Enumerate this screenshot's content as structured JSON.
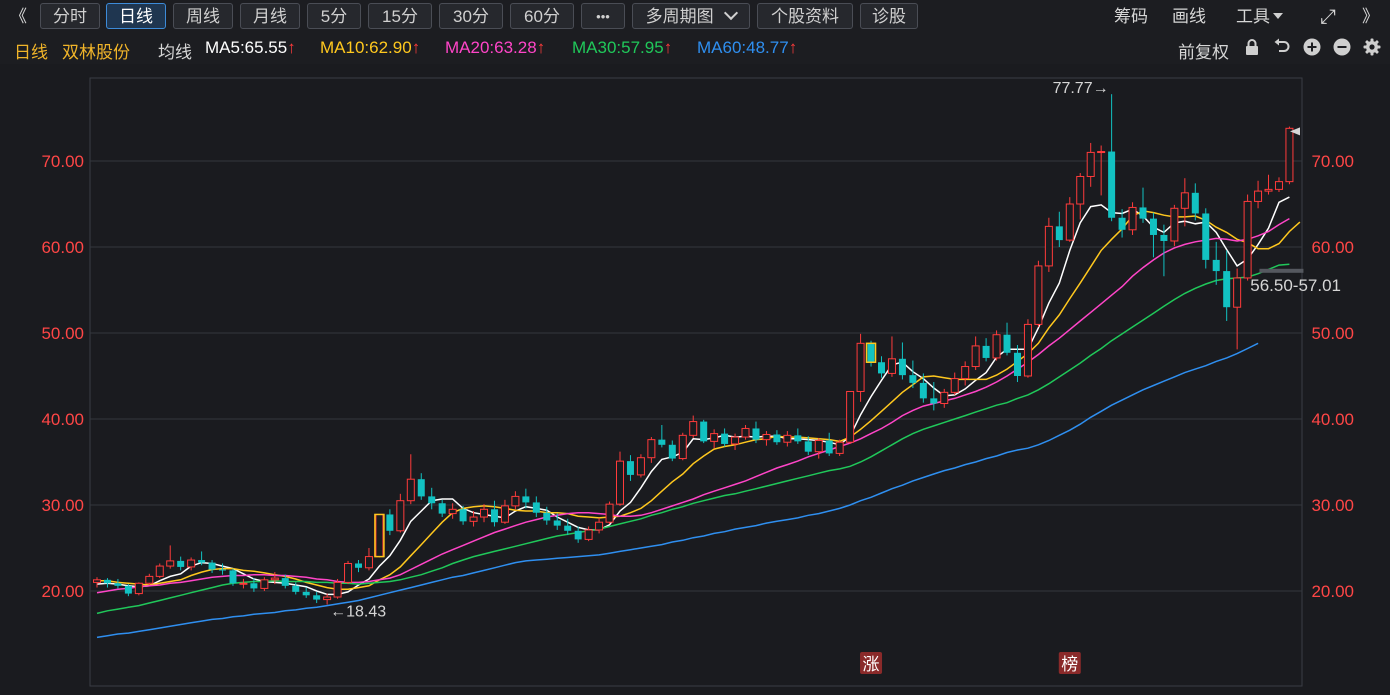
{
  "toolbar": {
    "back_glyph": "《",
    "tabs": [
      "分时",
      "日线",
      "周线",
      "月线",
      "5分",
      "15分",
      "30分",
      "60分",
      "•••"
    ],
    "multi_period": "多周期图",
    "stock_info": "个股资料",
    "diagnose": "诊股",
    "chips": "筹码",
    "draw": "画线",
    "tools": "工具",
    "expand_glyph": "⤢",
    "collapse_glyph": "》"
  },
  "legend": {
    "period": "日线",
    "stock_name": "双林股份",
    "ma_label": "均线",
    "ma5": "MA5:65.55",
    "ma10": "MA10:62.90",
    "ma20": "MA20:63.28",
    "ma30": "MA30:57.95",
    "ma60": "MA60:48.77",
    "adjust": "前复权"
  },
  "colors": {
    "up": "#ff3b3b",
    "down": "#12c2c2",
    "ma5": "#ffffff",
    "ma10": "#ffc81e",
    "ma20": "#ff45c8",
    "ma30": "#20c85a",
    "ma60": "#2f8ff0",
    "axis_text": "#ff4646"
  },
  "markers": {
    "zhang": "涨",
    "bang": "榜"
  },
  "chart_data": {
    "type": "candlestick",
    "ylim": [
      12,
      82
    ],
    "yticks": [
      "20.00",
      "30.00",
      "40.00",
      "50.00",
      "60.00",
      "70.00"
    ],
    "annotations": {
      "high": "77.77→",
      "low": "←18.43",
      "range": "56.50-57.01"
    },
    "candles": [
      [
        21.0,
        21.6,
        20.4,
        21.3
      ],
      [
        21.3,
        21.5,
        20.4,
        20.9
      ],
      [
        20.9,
        21.4,
        20.3,
        20.6
      ],
      [
        20.6,
        20.8,
        19.4,
        19.7
      ],
      [
        19.7,
        21.0,
        19.5,
        20.9
      ],
      [
        20.9,
        22.0,
        20.7,
        21.7
      ],
      [
        21.7,
        23.2,
        21.5,
        22.9
      ],
      [
        22.9,
        25.3,
        22.6,
        23.5
      ],
      [
        23.5,
        24.0,
        22.4,
        22.8
      ],
      [
        22.8,
        23.9,
        22.4,
        23.6
      ],
      [
        23.6,
        24.6,
        23.0,
        23.3
      ],
      [
        23.3,
        23.6,
        22.1,
        22.5
      ],
      [
        22.5,
        23.2,
        21.9,
        22.4
      ],
      [
        22.4,
        22.6,
        20.6,
        20.9
      ],
      [
        20.9,
        21.4,
        20.3,
        20.9
      ],
      [
        20.9,
        21.5,
        19.9,
        20.3
      ],
      [
        20.3,
        21.6,
        20.0,
        21.3
      ],
      [
        21.3,
        22.2,
        20.8,
        21.5
      ],
      [
        21.5,
        21.9,
        20.3,
        20.6
      ],
      [
        20.6,
        21.0,
        19.6,
        19.9
      ],
      [
        19.9,
        20.4,
        19.2,
        19.5
      ],
      [
        19.5,
        19.9,
        18.6,
        19.0
      ],
      [
        19.0,
        19.7,
        18.43,
        19.3
      ],
      [
        19.3,
        21.4,
        19.1,
        21.0
      ],
      [
        21.0,
        23.5,
        20.8,
        23.2
      ],
      [
        23.2,
        23.6,
        22.2,
        22.7
      ],
      [
        22.7,
        25.0,
        22.4,
        24.0
      ],
      [
        24.0,
        28.9,
        23.9,
        28.9
      ],
      [
        28.9,
        29.5,
        26.5,
        27.0
      ],
      [
        27.0,
        31.3,
        26.8,
        30.5
      ],
      [
        30.5,
        35.9,
        30.1,
        33.0
      ],
      [
        33.0,
        33.7,
        30.6,
        31.0
      ],
      [
        31.0,
        32.0,
        29.5,
        30.2
      ],
      [
        30.2,
        30.6,
        28.6,
        29.0
      ],
      [
        29.0,
        30.2,
        28.4,
        29.5
      ],
      [
        29.5,
        29.9,
        27.7,
        28.1
      ],
      [
        28.1,
        29.3,
        27.5,
        28.6
      ],
      [
        28.6,
        30.1,
        28.0,
        29.5
      ],
      [
        29.5,
        30.5,
        27.5,
        28.0
      ],
      [
        28.0,
        30.6,
        27.8,
        29.9
      ],
      [
        29.9,
        31.6,
        29.5,
        31.0
      ],
      [
        31.0,
        31.9,
        29.6,
        30.3
      ],
      [
        30.3,
        31.0,
        28.6,
        29.1
      ],
      [
        29.1,
        29.8,
        27.7,
        28.2
      ],
      [
        28.2,
        29.0,
        27.1,
        27.6
      ],
      [
        27.6,
        28.4,
        26.5,
        27.0
      ],
      [
        27.0,
        27.5,
        25.6,
        26.0
      ],
      [
        26.0,
        27.5,
        25.8,
        27.1
      ],
      [
        27.1,
        28.5,
        26.7,
        28.0
      ],
      [
        28.0,
        30.4,
        27.8,
        30.1
      ],
      [
        30.1,
        36.2,
        29.9,
        35.1
      ],
      [
        35.1,
        35.8,
        32.8,
        33.5
      ],
      [
        33.5,
        35.9,
        33.2,
        35.5
      ],
      [
        35.5,
        37.9,
        34.9,
        37.6
      ],
      [
        37.6,
        39.3,
        36.7,
        37.0
      ],
      [
        37.0,
        37.5,
        35.1,
        35.4
      ],
      [
        35.4,
        38.4,
        35.2,
        38.1
      ],
      [
        38.1,
        40.4,
        37.8,
        39.7
      ],
      [
        39.7,
        39.9,
        37.2,
        37.4
      ],
      [
        37.4,
        38.8,
        36.6,
        38.3
      ],
      [
        38.3,
        38.9,
        36.8,
        37.1
      ],
      [
        37.1,
        38.3,
        36.4,
        37.9
      ],
      [
        37.9,
        39.3,
        37.6,
        38.9
      ],
      [
        38.9,
        39.7,
        37.2,
        37.6
      ],
      [
        37.6,
        38.6,
        36.9,
        38.2
      ],
      [
        38.2,
        38.7,
        37.0,
        37.3
      ],
      [
        37.3,
        38.6,
        36.8,
        38.1
      ],
      [
        38.1,
        38.9,
        37.1,
        37.4
      ],
      [
        37.4,
        38.0,
        35.8,
        36.2
      ],
      [
        36.2,
        37.8,
        35.4,
        37.5
      ],
      [
        37.5,
        38.4,
        35.7,
        36.0
      ],
      [
        36.0,
        37.6,
        35.7,
        37.3
      ],
      [
        37.3,
        43.2,
        37.1,
        43.2
      ],
      [
        43.2,
        49.9,
        42.0,
        48.8
      ],
      [
        48.8,
        49.1,
        46.1,
        46.6
      ],
      [
        46.6,
        47.3,
        44.8,
        45.3
      ],
      [
        45.3,
        49.6,
        44.9,
        47.0
      ],
      [
        47.0,
        48.9,
        44.6,
        45.1
      ],
      [
        45.1,
        46.8,
        43.6,
        44.2
      ],
      [
        44.2,
        45.3,
        41.9,
        42.4
      ],
      [
        42.4,
        44.3,
        41.0,
        41.8
      ],
      [
        41.8,
        43.5,
        41.3,
        43.1
      ],
      [
        43.1,
        45.4,
        42.8,
        44.7
      ],
      [
        44.7,
        46.7,
        43.9,
        46.1
      ],
      [
        46.1,
        49.6,
        45.7,
        48.5
      ],
      [
        48.5,
        49.4,
        46.7,
        47.1
      ],
      [
        47.1,
        50.3,
        46.8,
        49.8
      ],
      [
        49.8,
        51.2,
        47.4,
        47.7
      ],
      [
        47.7,
        48.6,
        44.3,
        45.0
      ],
      [
        45.0,
        51.6,
        44.8,
        51.0
      ],
      [
        51.0,
        58.4,
        50.7,
        57.8
      ],
      [
        57.8,
        63.4,
        57.1,
        62.4
      ],
      [
        62.4,
        64.1,
        60.0,
        60.8
      ],
      [
        60.8,
        65.8,
        60.6,
        65.0
      ],
      [
        65.0,
        68.6,
        63.2,
        68.2
      ],
      [
        68.2,
        72.1,
        67.0,
        71.0
      ],
      [
        71.0,
        71.8,
        66.0,
        71.1
      ],
      [
        71.1,
        77.77,
        63.0,
        63.4
      ],
      [
        63.4,
        64.4,
        61.1,
        62.0
      ],
      [
        62.0,
        65.2,
        61.4,
        64.6
      ],
      [
        64.6,
        66.9,
        62.8,
        63.3
      ],
      [
        63.3,
        64.0,
        58.8,
        61.4
      ],
      [
        61.4,
        62.6,
        56.6,
        60.7
      ],
      [
        60.7,
        64.9,
        60.1,
        64.5
      ],
      [
        64.5,
        68.0,
        62.4,
        66.3
      ],
      [
        66.3,
        67.4,
        63.1,
        63.9
      ],
      [
        63.9,
        64.5,
        57.5,
        58.5
      ],
      [
        58.5,
        60.6,
        55.6,
        57.2
      ],
      [
        57.2,
        59.6,
        51.4,
        53.0
      ],
      [
        53.0,
        57.5,
        48.1,
        56.4
      ],
      [
        56.4,
        66.1,
        56.1,
        65.3
      ],
      [
        65.3,
        67.7,
        64.5,
        66.5
      ],
      [
        66.5,
        68.4,
        66.1,
        66.7
      ],
      [
        66.7,
        68.1,
        66.4,
        67.6
      ],
      [
        67.6,
        74.0,
        67.3,
        73.8
      ]
    ],
    "series": [
      {
        "name": "MA5",
        "values": [
          20.8,
          20.9,
          20.8,
          20.6,
          20.5,
          20.6,
          21.2,
          21.7,
          22.0,
          22.9,
          23.3,
          23.2,
          22.9,
          22.6,
          22.0,
          21.4,
          21.1,
          21.0,
          20.9,
          20.7,
          20.5,
          20.0,
          19.6,
          19.6,
          19.9,
          20.7,
          21.4,
          22.9,
          24.1,
          25.9,
          28.1,
          29.3,
          30.5,
          30.7,
          30.7,
          29.6,
          29.1,
          28.9,
          28.7,
          28.5,
          29.3,
          29.8,
          29.6,
          29.4,
          28.6,
          28.0,
          27.4,
          27.1,
          27.1,
          27.7,
          29.3,
          30.3,
          32.0,
          33.9,
          35.3,
          35.6,
          36.1,
          37.7,
          37.6,
          37.8,
          38.1,
          37.9,
          38.0,
          37.9,
          38.0,
          38.0,
          37.7,
          37.7,
          37.6,
          37.5,
          37.3,
          37.0,
          38.0,
          40.5,
          42.6,
          44.5,
          46.3,
          46.6,
          45.5,
          44.7,
          43.6,
          42.7,
          42.8,
          43.5,
          44.5,
          45.4,
          47.2,
          48.1,
          48.1,
          48.1,
          50.6,
          53.5,
          55.8,
          59.6,
          62.8,
          64.7,
          64.9,
          64.0,
          63.9,
          64.4,
          63.6,
          62.3,
          61.7,
          62.8,
          63.0,
          62.7,
          62.9,
          61.7,
          59.7,
          57.8,
          58.6,
          60.3,
          62.2,
          65.2,
          65.8
        ]
      },
      {
        "name": "MA10",
        "values": [
          21.2,
          21.2,
          21.0,
          20.9,
          20.8,
          20.7,
          20.9,
          21.1,
          21.3,
          21.8,
          22.2,
          22.5,
          22.6,
          22.6,
          22.4,
          22.3,
          22.1,
          21.9,
          21.7,
          21.4,
          21.0,
          20.7,
          20.4,
          20.2,
          20.2,
          20.4,
          20.6,
          21.3,
          21.9,
          22.8,
          24.1,
          25.4,
          26.7,
          28.0,
          29.1,
          29.6,
          29.8,
          29.9,
          29.8,
          29.6,
          29.4,
          29.3,
          29.3,
          29.1,
          29.1,
          29.0,
          28.7,
          28.6,
          28.5,
          28.6,
          28.7,
          29.1,
          29.6,
          30.5,
          31.6,
          32.7,
          33.6,
          34.8,
          35.7,
          36.5,
          36.8,
          37.0,
          37.3,
          37.6,
          37.7,
          38.0,
          37.9,
          37.9,
          37.8,
          37.7,
          37.6,
          37.4,
          37.9,
          38.8,
          39.8,
          40.9,
          42.0,
          43.1,
          44.0,
          44.9,
          45.0,
          44.8,
          44.6,
          44.6,
          44.6,
          44.6,
          45.1,
          45.8,
          46.7,
          47.6,
          48.8,
          50.6,
          52.1,
          54.0,
          55.8,
          57.7,
          59.6,
          60.9,
          62.1,
          63.6,
          64.2,
          64.0,
          63.7,
          63.5,
          63.5,
          63.6,
          63.1,
          62.3,
          61.7,
          60.9,
          60.5,
          59.8,
          59.8,
          60.4,
          61.8,
          62.9
        ]
      },
      {
        "name": "MA20",
        "values": [
          19.8,
          20.0,
          20.2,
          20.3,
          20.5,
          20.6,
          20.7,
          20.9,
          21.0,
          21.2,
          21.4,
          21.6,
          21.7,
          21.8,
          21.8,
          21.9,
          21.9,
          21.8,
          21.8,
          21.7,
          21.6,
          21.4,
          21.3,
          21.1,
          21.0,
          21.0,
          21.1,
          21.3,
          21.5,
          21.9,
          22.5,
          23.1,
          23.7,
          24.3,
          24.8,
          25.3,
          25.8,
          26.3,
          26.8,
          27.2,
          27.6,
          28.0,
          28.3,
          28.6,
          28.8,
          29.0,
          29.1,
          29.1,
          29.0,
          28.9,
          28.7,
          28.7,
          28.8,
          29.1,
          29.5,
          29.9,
          30.3,
          30.7,
          31.2,
          31.6,
          32.0,
          32.4,
          32.8,
          33.3,
          33.8,
          34.3,
          34.7,
          35.1,
          35.6,
          36.0,
          36.4,
          36.8,
          37.2,
          37.7,
          38.3,
          38.9,
          39.6,
          40.4,
          41.0,
          41.5,
          41.8,
          42.1,
          42.4,
          42.8,
          43.2,
          43.7,
          44.3,
          45.0,
          45.8,
          46.6,
          47.5,
          48.5,
          49.4,
          50.4,
          51.4,
          52.4,
          53.4,
          54.4,
          55.4,
          56.6,
          57.6,
          58.5,
          59.3,
          59.9,
          60.3,
          60.6,
          60.8,
          61.0,
          60.9,
          60.7,
          60.9,
          61.3,
          61.8,
          62.6,
          63.3
        ]
      },
      {
        "name": "MA30",
        "values": [
          17.4,
          17.7,
          17.9,
          18.1,
          18.3,
          18.6,
          18.9,
          19.2,
          19.5,
          19.8,
          20.1,
          20.4,
          20.7,
          20.9,
          21.0,
          21.1,
          21.1,
          21.2,
          21.1,
          21.1,
          21.1,
          21.0,
          21.0,
          20.9,
          20.9,
          20.8,
          20.9,
          21.0,
          21.1,
          21.3,
          21.6,
          21.9,
          22.3,
          22.7,
          23.2,
          23.6,
          24.0,
          24.3,
          24.6,
          24.9,
          25.2,
          25.5,
          25.8,
          26.1,
          26.4,
          26.6,
          26.8,
          27.0,
          27.2,
          27.5,
          27.8,
          28.1,
          28.4,
          28.8,
          29.1,
          29.5,
          29.8,
          30.2,
          30.5,
          30.8,
          31.1,
          31.3,
          31.6,
          31.9,
          32.2,
          32.5,
          32.8,
          33.1,
          33.4,
          33.7,
          34.0,
          34.2,
          34.5,
          35.0,
          35.6,
          36.3,
          37.0,
          37.7,
          38.3,
          38.8,
          39.2,
          39.6,
          40.0,
          40.4,
          40.8,
          41.2,
          41.6,
          41.9,
          42.4,
          42.8,
          43.4,
          44.1,
          44.9,
          45.7,
          46.5,
          47.4,
          48.2,
          49.1,
          49.9,
          50.7,
          51.5,
          52.3,
          53.1,
          53.9,
          54.6,
          55.2,
          55.7,
          56.1,
          56.3,
          56.4,
          56.5,
          56.9,
          57.4,
          57.9,
          58.0
        ]
      },
      {
        "name": "MA60",
        "values": [
          14.6,
          14.8,
          15.0,
          15.1,
          15.3,
          15.5,
          15.7,
          15.9,
          16.1,
          16.3,
          16.5,
          16.7,
          16.8,
          17.0,
          17.1,
          17.3,
          17.4,
          17.5,
          17.7,
          17.8,
          18.0,
          18.1,
          18.3,
          18.5,
          18.7,
          18.9,
          19.2,
          19.5,
          19.8,
          20.1,
          20.4,
          20.7,
          21.0,
          21.3,
          21.6,
          21.8,
          22.1,
          22.4,
          22.7,
          23.0,
          23.3,
          23.5,
          23.6,
          23.7,
          23.8,
          23.9,
          24.0,
          24.1,
          24.2,
          24.4,
          24.6,
          24.8,
          25.0,
          25.2,
          25.4,
          25.7,
          25.9,
          26.2,
          26.4,
          26.7,
          26.9,
          27.2,
          27.4,
          27.6,
          27.9,
          28.1,
          28.3,
          28.5,
          28.8,
          29.0,
          29.3,
          29.6,
          30.0,
          30.5,
          30.9,
          31.4,
          31.9,
          32.3,
          32.8,
          33.2,
          33.6,
          34.0,
          34.3,
          34.7,
          35.0,
          35.4,
          35.7,
          36.1,
          36.4,
          36.6,
          37.0,
          37.5,
          38.1,
          38.7,
          39.4,
          40.2,
          40.9,
          41.6,
          42.2,
          42.8,
          43.4,
          43.9,
          44.4,
          44.9,
          45.4,
          45.8,
          46.2,
          46.7,
          47.1,
          47.6,
          48.2,
          48.8
        ]
      }
    ]
  }
}
